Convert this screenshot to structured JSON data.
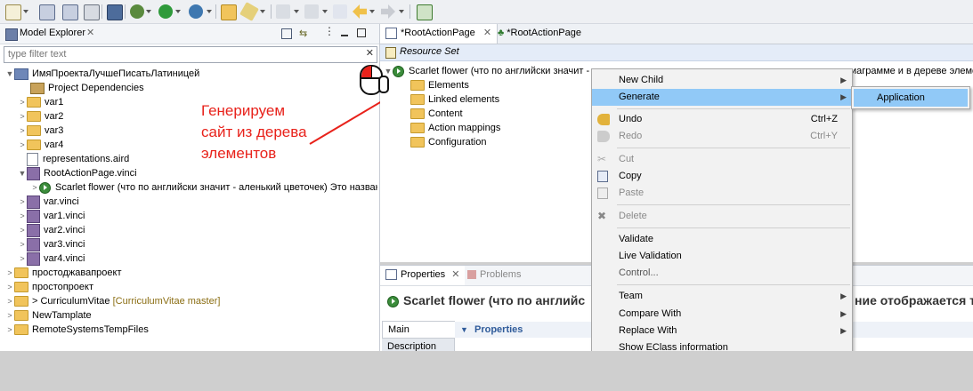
{
  "explorer": {
    "title": "Model Explorer",
    "filter_placeholder": "type filter text",
    "tree": [
      {
        "label": "ИмяПроектаЛучшеПисатьЛатиницей"
      },
      {
        "label": "Project Dependencies"
      },
      {
        "label": "var1"
      },
      {
        "label": "var2"
      },
      {
        "label": "var3"
      },
      {
        "label": "var4"
      },
      {
        "label": "representations.aird"
      },
      {
        "label": "RootActionPage.vinci"
      },
      {
        "label": "Scarlet flower (что по английски значит - аленький цветочек) Это названи"
      },
      {
        "label": "var.vinci"
      },
      {
        "label": "var1.vinci"
      },
      {
        "label": "var2.vinci"
      },
      {
        "label": "var3.vinci"
      },
      {
        "label": "var4.vinci"
      },
      {
        "label": "простоджавапроект"
      },
      {
        "label": "простопроект"
      },
      {
        "label": "> CurriculumVitae",
        "decoration": "[CurriculumVitae master]"
      },
      {
        "label": "NewTamplate"
      },
      {
        "label": "RemoteSystemsTempFiles"
      }
    ]
  },
  "annotation": {
    "lines": [
      "Генерируем",
      "сайт из дерева",
      "элементов"
    ],
    "color": "#e8221b"
  },
  "editor": {
    "tabs": [
      {
        "label": "*RootActionPage"
      },
      {
        "label": "*RootActionPage"
      }
    ],
    "resource_set": "Resource Set",
    "root_item_left": "Scarlet flower (что по английски значит -",
    "root_item_right": "иаграмме и в дереве элеме",
    "children": [
      "Elements",
      "Linked elements",
      "Content",
      "Action mappings",
      "Configuration"
    ]
  },
  "properties": {
    "tabs": [
      {
        "label": "Properties"
      },
      {
        "label": "Problems"
      }
    ],
    "heading_left": "Scarlet flower (что по английс",
    "heading_right": "ние отображается т",
    "side_tabs": [
      "Main",
      "Description"
    ],
    "section": "Properties"
  },
  "context_menu": {
    "items": [
      {
        "label": "New Child",
        "submenu": true
      },
      {
        "label": "Generate",
        "submenu": true,
        "highlighted": true
      },
      {
        "label": "Undo",
        "shortcut": "Ctrl+Z"
      },
      {
        "label": "Redo",
        "shortcut": "Ctrl+Y",
        "disabled": true
      },
      {
        "label": "Cut",
        "disabled": true
      },
      {
        "label": "Copy"
      },
      {
        "label": "Paste",
        "disabled": true
      },
      {
        "label": "Delete",
        "disabled": true
      },
      {
        "label": "Validate"
      },
      {
        "label": "Live Validation"
      },
      {
        "label": "Control..."
      },
      {
        "label": "Team",
        "submenu": true
      },
      {
        "label": "Compare With",
        "submenu": true
      },
      {
        "label": "Replace With",
        "submenu": true
      },
      {
        "label": "Show EClass information"
      }
    ],
    "submenu_item": "Application",
    "highlight_color": "#91c9f7"
  }
}
